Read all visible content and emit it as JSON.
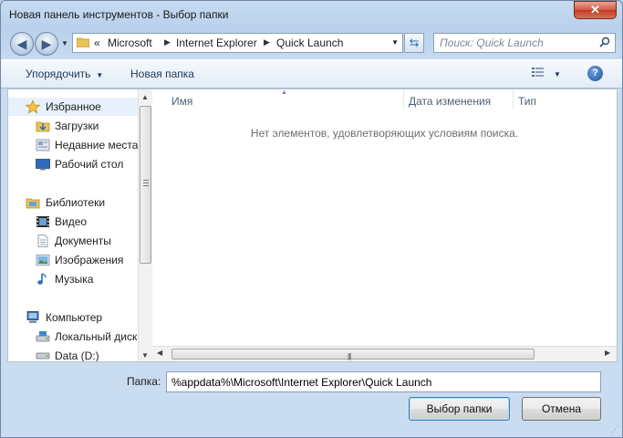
{
  "window": {
    "title": "Новая панель инструментов - Выбор папки",
    "close_glyph": "✕"
  },
  "address_bar": {
    "overflow": "«",
    "crumbs": [
      "Microsoft",
      "Internet Explorer",
      "Quick Launch"
    ],
    "separator": "▶"
  },
  "search": {
    "placeholder": "Поиск: Quick Launch"
  },
  "toolbar": {
    "organize_label": "Упорядочить",
    "new_folder_label": "Новая папка",
    "help_glyph": "?"
  },
  "nav_pane": {
    "favorites": {
      "label": "Избранное",
      "icon": "star-icon",
      "items": [
        {
          "label": "Загрузки",
          "icon": "downloads-icon"
        },
        {
          "label": "Недавние места",
          "icon": "recent-places-icon"
        },
        {
          "label": "Рабочий стол",
          "icon": "desktop-icon"
        }
      ]
    },
    "libraries": {
      "label": "Библиотеки",
      "icon": "libraries-icon",
      "items": [
        {
          "label": "Видео",
          "icon": "video-icon"
        },
        {
          "label": "Документы",
          "icon": "documents-icon"
        },
        {
          "label": "Изображения",
          "icon": "pictures-icon"
        },
        {
          "label": "Музыка",
          "icon": "music-icon"
        }
      ]
    },
    "computer": {
      "label": "Компьютер",
      "icon": "computer-icon",
      "items": [
        {
          "label": "Локальный диск",
          "icon": "local-disk-icon"
        },
        {
          "label": "Data (D:)",
          "icon": "drive-icon"
        }
      ]
    }
  },
  "file_list": {
    "columns": [
      "Имя",
      "Дата изменения",
      "Тип"
    ],
    "empty_message": "Нет элементов, удовлетворяющих условиям поиска."
  },
  "footer": {
    "folder_label": "Папка:",
    "folder_value": "%appdata%\\Microsoft\\Internet Explorer\\Quick Launch",
    "select_button": "Выбор папки",
    "cancel_button": "Отмена"
  },
  "colors": {
    "accent": "#3c7fb1",
    "title_bar": "#b9d1ec",
    "close_button": "#c03a20"
  }
}
